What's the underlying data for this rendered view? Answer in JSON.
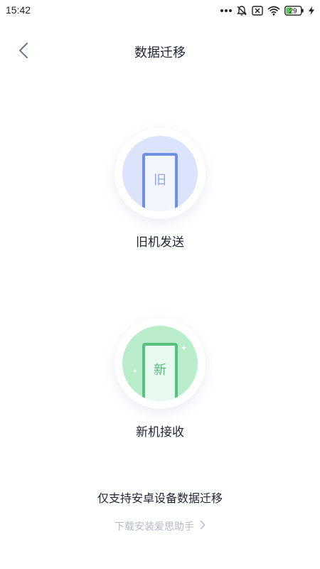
{
  "status_bar": {
    "time": "15:42",
    "battery_level": "29",
    "icons": [
      "more-dots-icon",
      "mute-bell-icon",
      "no-sim-icon",
      "wifi-icon",
      "battery-icon",
      "charging-icon"
    ]
  },
  "header": {
    "title": "数据迁移",
    "back_icon": "chevron-left-icon"
  },
  "options": {
    "old": {
      "phone_char": "旧",
      "label": "旧机发送",
      "circle_color": "#dbe4fb",
      "accent_color": "#6f90e4"
    },
    "new": {
      "phone_char": "新",
      "label": "新机接收",
      "circle_color": "#b9edcb",
      "accent_color": "#58c182"
    }
  },
  "footer": {
    "note": "仅支持安卓设备数据迁移",
    "download_link": "下载安装爱思助手",
    "link_icon": "chevron-right-icon"
  }
}
